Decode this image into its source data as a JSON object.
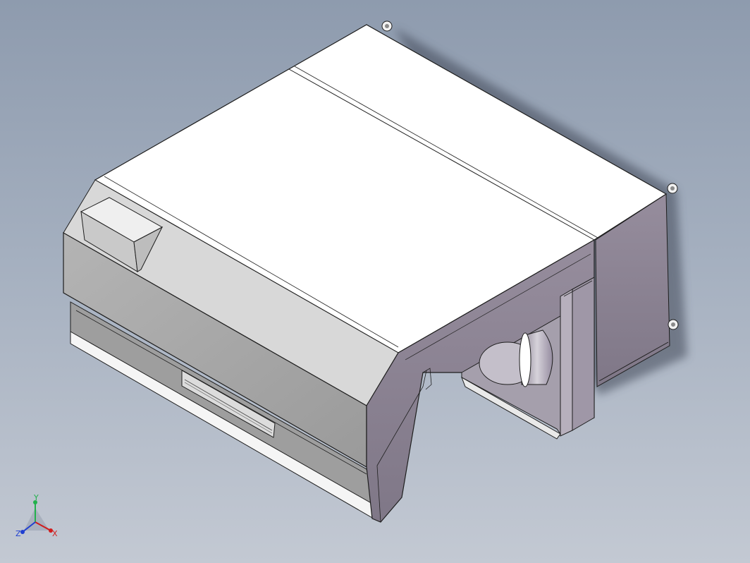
{
  "viewport": {
    "background_top": "#8e9bae",
    "background_bottom": "#c3c9d3"
  },
  "model": {
    "face_colors": {
      "top": "#ffffff",
      "front_side": "#a9a9a9",
      "right_side": "#8f8696",
      "edge": "#1e1e1e"
    }
  },
  "triad": {
    "x_label": "X",
    "y_label": "Y",
    "z_label": "Z",
    "x_color": "#d11c1c",
    "y_color": "#22b14c",
    "z_color": "#1f3fd1"
  }
}
